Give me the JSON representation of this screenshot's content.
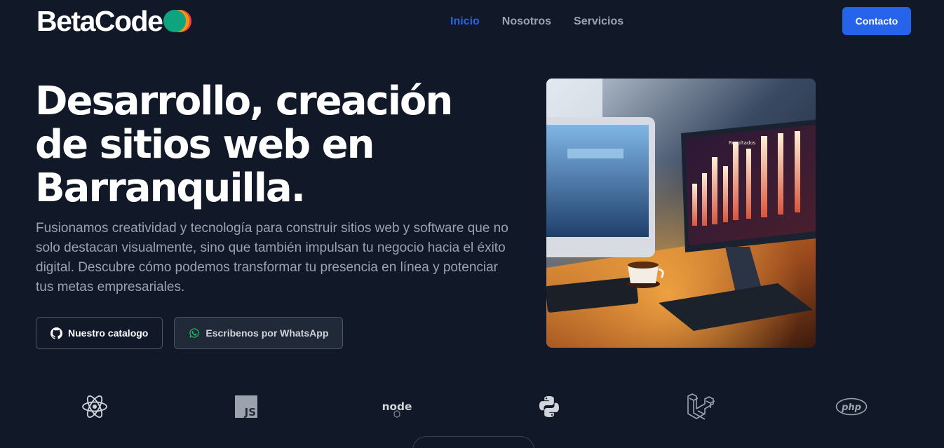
{
  "header": {
    "logo_text": "BetaCode",
    "nav": [
      {
        "label": "Inicio",
        "active": true
      },
      {
        "label": "Nosotros",
        "active": false
      },
      {
        "label": "Servicios",
        "active": false
      }
    ],
    "contact_label": "Contacto"
  },
  "hero": {
    "title": "Desarrollo, creación de sitios web en Barranquilla.",
    "description": "Fusionamos creatividad y tecnología para construir sitios web y software que no solo destacan visualmente, sino que también impulsan tu negocio hacia el éxito digital. Descubre cómo podemos transformar tu presencia en línea y potenciar tus metas empresariales.",
    "buttons": [
      {
        "label": "Nuestro catalogo",
        "icon": "github-icon"
      },
      {
        "label": "Escribenos por WhatsApp",
        "icon": "whatsapp-icon"
      }
    ],
    "image_caption": "Resultados"
  },
  "tech_logos": [
    {
      "name": "react-icon"
    },
    {
      "name": "javascript-icon",
      "text": "JS"
    },
    {
      "name": "nodejs-icon",
      "text": "node"
    },
    {
      "name": "python-icon"
    },
    {
      "name": "laravel-icon"
    },
    {
      "name": "php-icon",
      "text": "php"
    }
  ],
  "colors": {
    "background": "#111827",
    "accent": "#2563eb",
    "muted_text": "#9ca3af",
    "logo_colors": [
      "#10a37f",
      "#f59e0b",
      "#ef4444"
    ]
  }
}
